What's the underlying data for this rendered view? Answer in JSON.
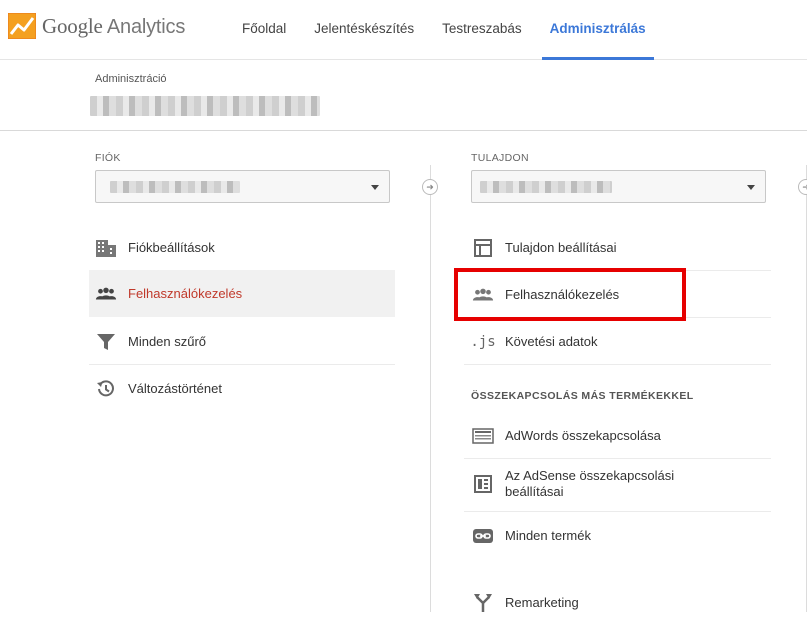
{
  "header": {
    "logo_google": "Google",
    "logo_analytics": "Analytics",
    "nav": [
      {
        "label": "Főoldal",
        "active": false
      },
      {
        "label": "Jelentéskészítés",
        "active": false
      },
      {
        "label": "Testreszabás",
        "active": false
      },
      {
        "label": "Adminisztrálás",
        "active": true
      }
    ]
  },
  "breadcrumb": {
    "label": "Adminisztráció"
  },
  "account": {
    "label": "FIÓK",
    "items": [
      {
        "label": "Fiókbeállítások",
        "icon": "building-icon"
      },
      {
        "label": "Felhasználókezelés",
        "icon": "users-icon",
        "selected": true
      },
      {
        "label": "Minden szűrő",
        "icon": "filter-icon"
      },
      {
        "label": "Változástörténet",
        "icon": "history-icon"
      }
    ]
  },
  "property": {
    "label": "TULAJDON",
    "items": [
      {
        "label": "Tulajdon beállításai",
        "icon": "layout-icon"
      },
      {
        "label": "Felhasználókezelés",
        "icon": "users-icon"
      },
      {
        "label": "Követési adatok",
        "icon": "js-icon",
        "icon_text": ".js"
      }
    ],
    "section_label": "ÖSSZEKAPCSOLÁS MÁS TERMÉKEKKEL",
    "linked_items": [
      {
        "label": "AdWords összekapcsolása",
        "icon": "adwords-icon"
      },
      {
        "label": "Az AdSense összekapcsolási beállításai",
        "icon": "adsense-icon"
      },
      {
        "label": "Minden termék",
        "icon": "link-icon"
      },
      {
        "label": "Remarketing",
        "icon": "fork-icon"
      }
    ]
  },
  "colors": {
    "accent": "#3c78d8",
    "selected_text": "#c0392b",
    "highlight": "#e60000"
  }
}
